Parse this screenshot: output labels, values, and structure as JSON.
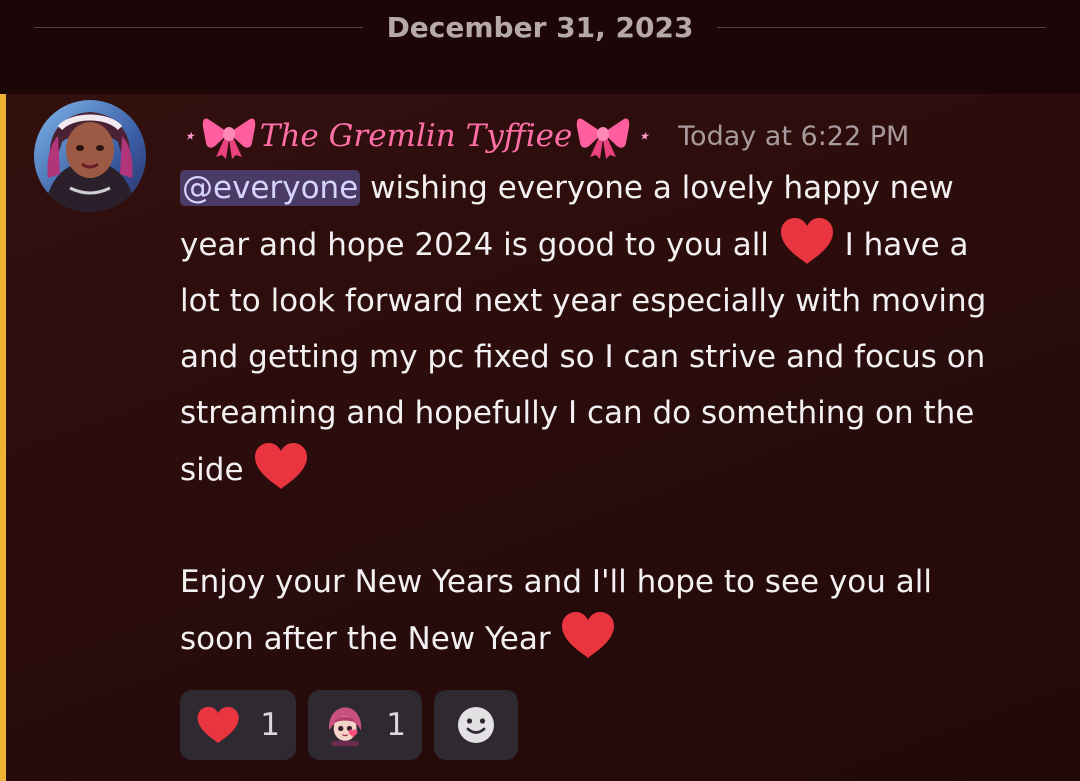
{
  "date_divider": "December 31, 2023",
  "message": {
    "username": "The Gremlin Tyffiee",
    "username_prefix": "⋆",
    "username_suffix": "⋆",
    "timestamp": "Today at 6:22 PM",
    "mention": "@everyone",
    "line1_rest": " wishing everyone a lovely happy new",
    "line2_a": "year and hope 2024 is good to you all ",
    "line2_b": " I have a",
    "line3": "lot to look forward next year especially with moving",
    "line4": "and getting my pc fixed so I can strive and focus on",
    "line5": "streaming and hopefully I can do something on the",
    "line6": "side ",
    "line7": "Enjoy your New Years and I'll hope to see you all",
    "line8": "soon after the New Year ",
    "emoji": "heart-emoji"
  },
  "reactions": [
    {
      "icon": "heart-emoji",
      "count": "1"
    },
    {
      "icon": "custom-avatar-emoji",
      "count": "1"
    }
  ],
  "add_reaction_icon": "smiley-add-reaction-icon",
  "colors": {
    "mention_bar": "#f0b232",
    "username": "#ff6fa7",
    "mention_bg": "#4a3a66",
    "heart": "#e8353f"
  }
}
